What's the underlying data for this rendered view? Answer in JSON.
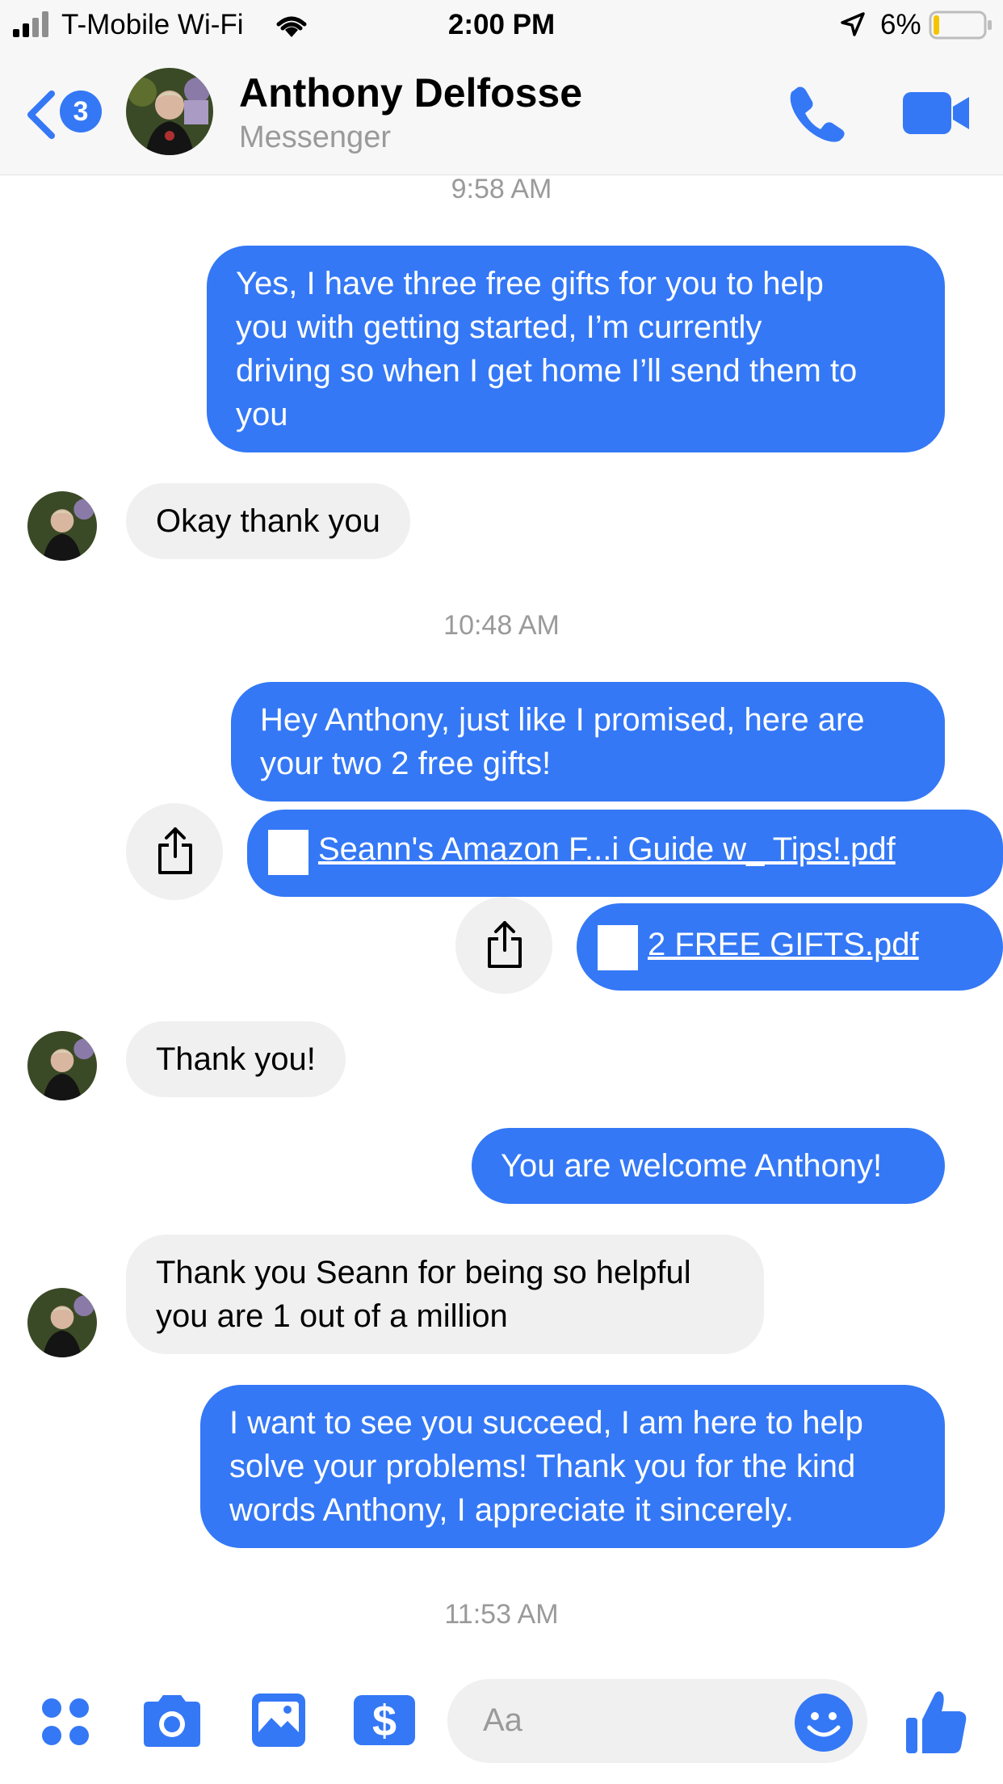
{
  "status_bar": {
    "carrier": "T-Mobile Wi-Fi",
    "time": "2:00 PM",
    "battery": "6%"
  },
  "header": {
    "back_badge": "3",
    "title": "Anthony Delfosse",
    "subtitle": "Messenger"
  },
  "thread": {
    "timestamps": [
      "9:58 AM",
      "10:48 AM",
      "11:53 AM"
    ],
    "messages": [
      {
        "lines": [
          "Yes, I have three free gifts for you to help",
          "you with getting started, I’m currently",
          "driving so when I get home I’ll send them to",
          "you"
        ]
      },
      {
        "lines": [
          "Okay thank you"
        ]
      },
      {
        "lines": [
          "Hey Anthony, just like I promised, here are",
          "your two 2 free gifts!"
        ]
      },
      {
        "lines": [
          "Thank you!"
        ]
      },
      {
        "lines": [
          "You are welcome Anthony!"
        ]
      },
      {
        "lines": [
          "Thank you Seann for being so helpful",
          "you are 1 out of a million"
        ]
      },
      {
        "lines": [
          "I want to see you succeed, I am here to help",
          "solve your problems! Thank you for the kind",
          "words Anthony, I appreciate it sincerely."
        ]
      }
    ],
    "attachments": [
      {
        "name": "Seann's Amazon F...i Guide w_ Tips!.pdf"
      },
      {
        "name": "2 FREE GIFTS.pdf"
      }
    ]
  },
  "composer": {
    "placeholder": "Aa"
  },
  "colors": {
    "accent": "#3478f6",
    "incoming_bubble": "#f0f0f0",
    "timestamp_text": "#9a9a9a"
  },
  "icons": [
    "signal-icon",
    "wifi-icon",
    "location-arrow-icon",
    "battery-icon",
    "back-chevron-icon",
    "phone-icon",
    "video-camera-icon",
    "share-icon",
    "file-icon",
    "apps-grid-icon",
    "camera-icon",
    "photo-icon",
    "payment-icon",
    "emoji-icon",
    "thumbs-up-icon"
  ]
}
